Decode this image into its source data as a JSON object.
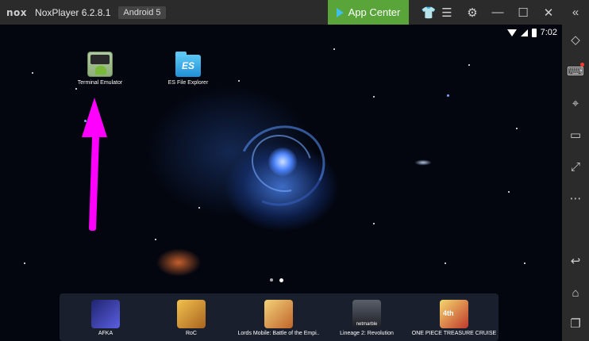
{
  "titlebar": {
    "logo": "nox",
    "app_title": "NoxPlayer 6.2.8.1",
    "android_badge": "Android 5",
    "app_center": "App Center",
    "icons": [
      "shirt-icon",
      "menu-icon",
      "gear-icon",
      "minimize-icon",
      "maximize-icon",
      "close-icon",
      "collapse-icon"
    ],
    "glyphs": {
      "shirt": "👕",
      "menu": "☰",
      "gear": "⚙",
      "minimize": "—",
      "maximize": "☐",
      "close": "✕",
      "collapse": "«"
    }
  },
  "status": {
    "time": "7:02"
  },
  "desktop": {
    "apps": [
      {
        "label": "Terminal Emulator",
        "icon": "terminal-icon"
      },
      {
        "label": "ES File Explorer",
        "icon": "es-file-icon",
        "glyph": "ES"
      }
    ]
  },
  "dock": {
    "apps": [
      {
        "label": "AFKA",
        "color": "#3a3fa8"
      },
      {
        "label": "RoC",
        "color": "#c98a2e"
      },
      {
        "label": "Lords Mobile: Battle of the Empi..",
        "color": "#d9a23a"
      },
      {
        "label": "Lineage 2: Revolution",
        "color": "#3b3f4a"
      },
      {
        "label": "ONE PIECE TREASURE CRUISE",
        "color": "#c0392b"
      }
    ],
    "netmarble_text": "netmarble",
    "onepiece_badge": "4th"
  },
  "sidebar": {
    "icons": [
      "rotate-icon",
      "keyboard-icon",
      "location-icon",
      "screen-icon",
      "fullscreen-icon",
      "more-icon",
      "back-icon",
      "home-icon",
      "recents-icon"
    ],
    "glyphs": {
      "rotate": "◇",
      "keyboard": "⌨",
      "location": "⌖",
      "screen": "▭",
      "fullscreen": "⤢",
      "more": "⋯",
      "back": "↩",
      "home": "⌂",
      "recents": "❐"
    }
  },
  "colors": {
    "accent_green": "#5aa53a",
    "annotation_arrow": "#ff00ff",
    "titlebar": "#2b2b2b"
  }
}
